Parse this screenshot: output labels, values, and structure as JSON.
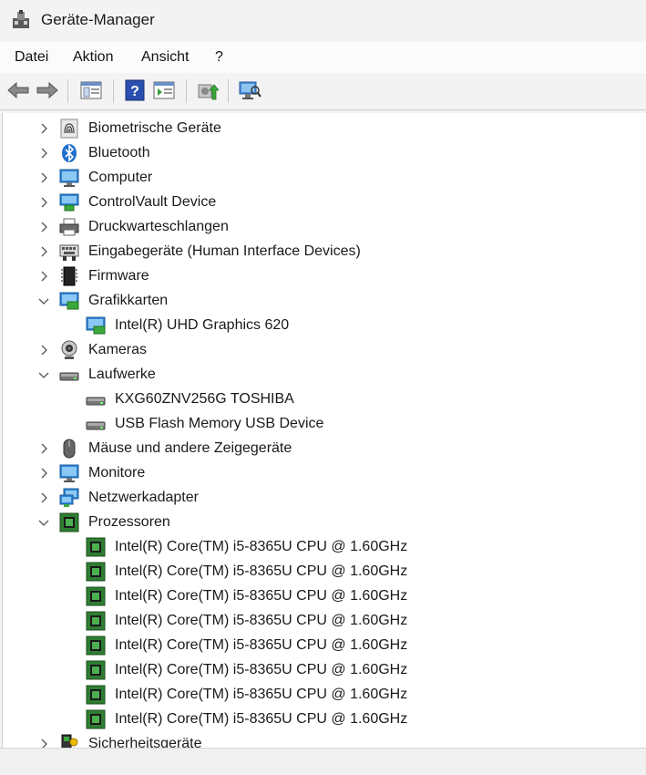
{
  "window": {
    "title": "Geräte-Manager"
  },
  "menu": {
    "items": [
      "Datei",
      "Aktion",
      "Ansicht",
      "?"
    ]
  },
  "tree": {
    "biometric": "Biometrische Geräte",
    "bluetooth": "Bluetooth",
    "computer": "Computer",
    "controlvault": "ControlVault Device",
    "printqueues": "Druckwarteschlangen",
    "hid": "Eingabegeräte (Human Interface Devices)",
    "firmware": "Firmware",
    "display": "Grafikkarten",
    "display_child": "Intel(R) UHD Graphics 620",
    "cameras": "Kameras",
    "drives": "Laufwerke",
    "drive1": "KXG60ZNV256G TOSHIBA",
    "drive2": "USB Flash Memory USB Device",
    "mice": "Mäuse und andere Zeigegeräte",
    "monitors": "Monitore",
    "network": "Netzwerkadapter",
    "processors": "Prozessoren",
    "cpu": "Intel(R) Core(TM) i5-8365U CPU @ 1.60GHz",
    "security": "Sicherheitsgeräte"
  },
  "colors": {
    "accent": "#0a64c8",
    "chip_green": "#2e7d32"
  }
}
